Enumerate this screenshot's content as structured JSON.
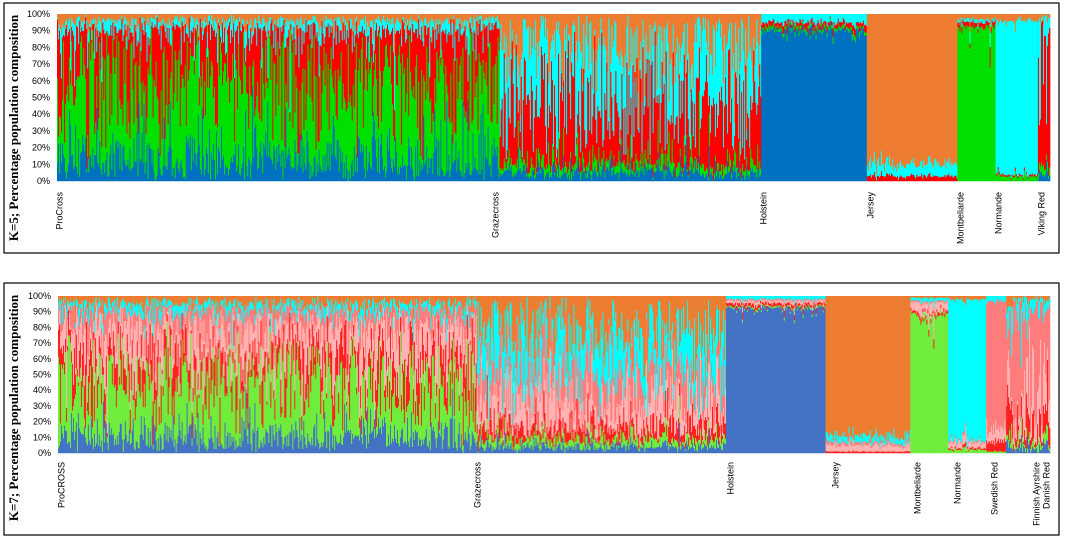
{
  "chart_data": [
    {
      "type": "bar",
      "subtype": "stacked-admixture",
      "ylabel": "K=5; Percentage population composition",
      "yticks": [
        "0%",
        "10%",
        "20%",
        "30%",
        "40%",
        "50%",
        "60%",
        "70%",
        "80%",
        "90%",
        "100%"
      ],
      "ylim": [
        0,
        100
      ],
      "cluster_colors": [
        "#0070c0",
        "#00e000",
        "#ff0000",
        "#00ffff",
        "#ed7d31"
      ],
      "populations": [
        {
          "label": "ProCross",
          "n": 440,
          "mean": [
            12,
            50,
            32,
            4,
            2
          ]
        },
        {
          "label": "Grazecross",
          "n": 260,
          "mean": [
            3,
            3,
            38,
            36,
            20
          ]
        },
        {
          "label": "Holstein",
          "n": 105,
          "mean": [
            90,
            2,
            3,
            5,
            0
          ]
        },
        {
          "label": "Jersey",
          "n": 90,
          "mean": [
            0,
            0,
            3,
            7,
            90
          ]
        },
        {
          "label": "Montbeliarde",
          "n": 38,
          "mean": [
            0,
            92,
            3,
            2,
            3
          ]
        },
        {
          "label": "Normande",
          "n": 42,
          "mean": [
            0,
            3,
            1,
            92,
            4
          ]
        },
        {
          "label": "Viking Red",
          "n": 12,
          "mean": [
            2,
            3,
            75,
            20,
            0
          ]
        }
      ]
    },
    {
      "type": "bar",
      "subtype": "stacked-admixture",
      "ylabel": "K=7; Percentage population composition",
      "yticks": [
        "0%",
        "10%",
        "20%",
        "30%",
        "40%",
        "50%",
        "60%",
        "70%",
        "80%",
        "90%",
        "100%"
      ],
      "ylim": [
        0,
        100
      ],
      "cluster_colors": [
        "#4472c4",
        "#70ed3c",
        "#ff2020",
        "#ffb3b3",
        "#ff7c7c",
        "#00ffff",
        "#ed7d31"
      ],
      "populations": [
        {
          "label": "ProCROSS",
          "n": 420,
          "mean": [
            10,
            40,
            14,
            20,
            10,
            3,
            3
          ]
        },
        {
          "label": "Grazecross",
          "n": 250,
          "mean": [
            2,
            3,
            7,
            16,
            20,
            28,
            24
          ]
        },
        {
          "label": "Holstein",
          "n": 100,
          "mean": [
            92,
            1,
            2,
            2,
            1,
            2,
            0
          ]
        },
        {
          "label": "Jersey",
          "n": 85,
          "mean": [
            0,
            0,
            1,
            4,
            2,
            4,
            89
          ]
        },
        {
          "label": "Montbeliarde",
          "n": 38,
          "mean": [
            0,
            88,
            2,
            6,
            1,
            2,
            1
          ]
        },
        {
          "label": "Normande",
          "n": 38,
          "mean": [
            0,
            2,
            1,
            4,
            1,
            90,
            2
          ]
        },
        {
          "label": "Swedish Red",
          "n": 20,
          "mean": [
            0,
            1,
            6,
            8,
            82,
            3,
            0
          ]
        },
        {
          "label": "Finnish Ayrshire",
          "n": 34,
          "mean": [
            0,
            1,
            5,
            12,
            78,
            4,
            0
          ]
        },
        {
          "label": "Danish Red",
          "n": 10,
          "mean": [
            1,
            1,
            10,
            20,
            65,
            3,
            0
          ]
        }
      ]
    }
  ]
}
